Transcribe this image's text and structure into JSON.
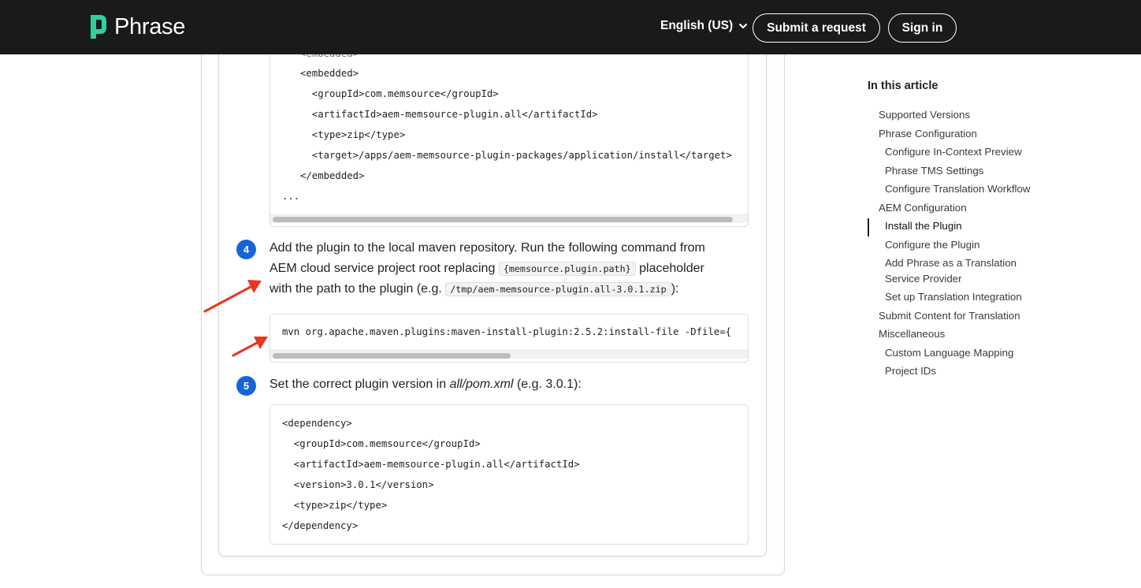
{
  "header": {
    "logo_text": "Phrase",
    "language_label": "English (US)",
    "submit_request_label": "Submit a request",
    "sign_in_label": "Sign in"
  },
  "colors": {
    "header_bg": "#1a1a1a",
    "step_badge": "#1565d8",
    "logo_accent": "#2fd0a0",
    "annotation_arrow": "#e8361f"
  },
  "code_block_top": {
    "lines": [
      "<embedded>",
      "  <groupId>com.memsource</groupId>",
      "  <artifactId>aem-memsource-plugin.all</artifactId>",
      "  <type>zip</type>",
      "  <target>/apps/aem-memsource-plugin-packages/application/install</target>",
      "</embedded>",
      "..."
    ]
  },
  "step4": {
    "number": "4",
    "text_part1": "Add the plugin to the local maven repository. Run the following command from",
    "text_part2a": "AEM cloud service project root replacing",
    "code1": "{memsource.plugin.path}",
    "text_part2b": "placeholder",
    "text_part3a": "with the path to the plugin (e.g.",
    "code2": "/tmp/aem-memsource-plugin.all-3.0.1.zip",
    "text_part3b": "):",
    "command": "mvn org.apache.maven.plugins:maven-install-plugin:2.5.2:install-file -Dfile={"
  },
  "step5": {
    "number": "5",
    "text_prefix": "Set the correct plugin version in",
    "file": "all/pom.xml",
    "text_suffix": "(e.g. 3.0.1):",
    "lines": [
      "<dependency>",
      "  <groupId>com.memsource</groupId>",
      "  <artifactId>aem-memsource-plugin.all</artifactId>",
      "  <version>3.0.1</version>",
      "  <type>zip</type>",
      "</dependency>"
    ]
  },
  "toc": {
    "title": "In this article",
    "items": [
      "Supported Versions",
      "Phrase Configuration",
      "Configure In-Context Preview",
      "Phrase TMS Settings",
      "Configure Translation Workflow",
      "AEM Configuration",
      "Install the Plugin",
      "Configure the Plugin",
      "Add Phrase as a Translation",
      "Service Provider",
      "Set up Translation Integration",
      "Submit Content for Translation",
      "Miscellaneous",
      "Custom Language Mapping",
      "Project IDs"
    ]
  }
}
